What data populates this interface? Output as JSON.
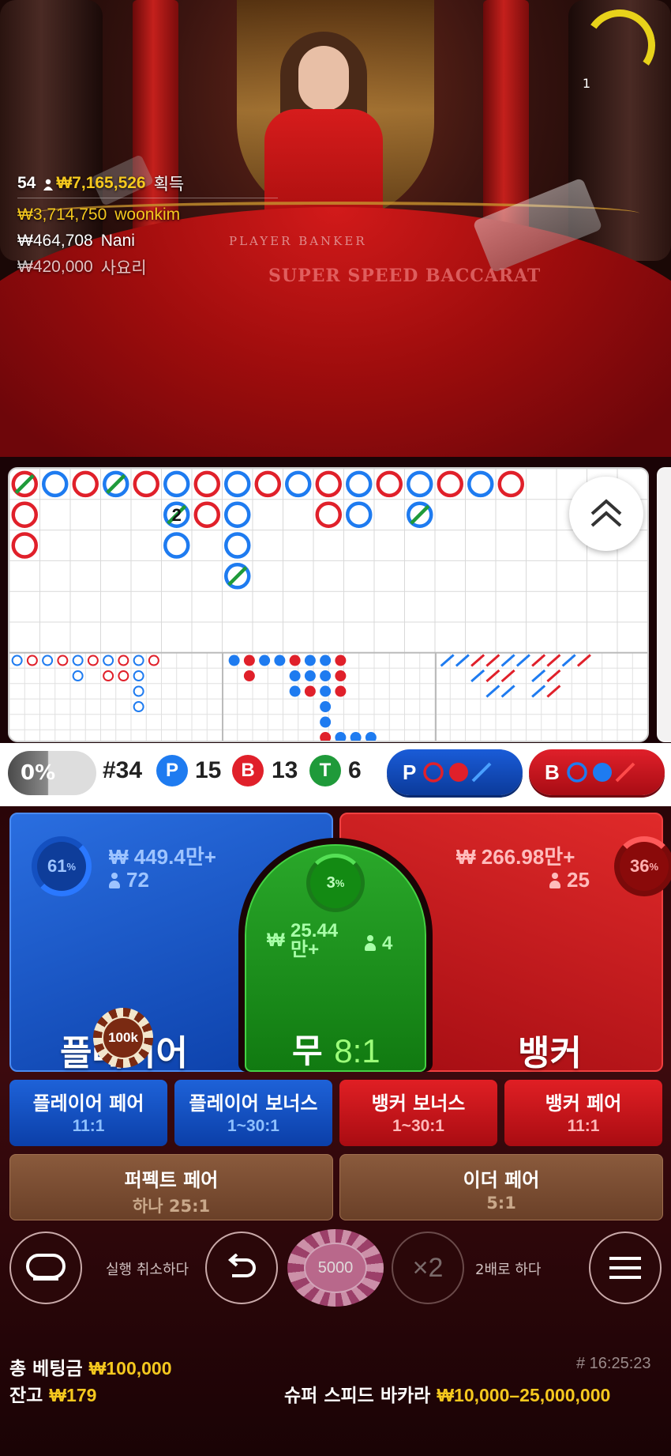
{
  "video": {
    "timer_value": "1",
    "table_print": "PLAYER        BANKER",
    "table_logo": "SUPER SPEED BACCARAT"
  },
  "winners": {
    "player_count": "54",
    "total_won": "₩7,165,526",
    "total_won_suffix": "획득",
    "rows": [
      {
        "amount": "₩3,714,750",
        "name": "woonkim"
      },
      {
        "amount": "₩464,708",
        "name": "Nani"
      },
      {
        "amount": "₩420,000",
        "name": "사요리"
      }
    ]
  },
  "roadmap": {
    "bead_marker": "2",
    "colors": {
      "player": "#1e7bf0",
      "banker": "#e0202a",
      "tie": "#1f9a3a"
    }
  },
  "stats": {
    "percent": "0%",
    "round": "#34",
    "player_letter": "P",
    "player_count": "15",
    "banker_letter": "B",
    "banker_count": "13",
    "tie_letter": "T",
    "tie_count": "6",
    "player_ask_label": "P",
    "banker_ask_label": "B"
  },
  "bets": {
    "player": {
      "pct": "61",
      "pct_sign": "%",
      "amount": "₩ 449.4만+",
      "bettors": "72",
      "label": "플레이어"
    },
    "banker": {
      "pct": "36",
      "pct_sign": "%",
      "amount": "₩ 266.98만+",
      "bettors": "25",
      "label": "뱅커"
    },
    "tie": {
      "pct": "3",
      "pct_sign": "%",
      "amount_line1": "25.44",
      "amount_prefix": "₩",
      "amount_line2": "만+",
      "bettors": "4",
      "label": "무",
      "odds": "8:1"
    },
    "placed_chip": "100k",
    "side_bets": [
      {
        "title": "플레이어 페어",
        "odds": "11:1"
      },
      {
        "title": "플레이어 보너스",
        "odds": "1~30:1"
      },
      {
        "title": "뱅커 보너스",
        "odds": "1~30:1"
      },
      {
        "title": "뱅커 페어",
        "odds": "11:1"
      }
    ],
    "perfect_pair": {
      "title": "퍼펙트 페어",
      "odds": "하나 25:1"
    },
    "either_pair": {
      "title": "이더 페어",
      "odds": "5:1"
    }
  },
  "controls": {
    "undo_label": "실행 취소하다",
    "chip_value": "5000",
    "double_label": "2배로 하다",
    "double_symbol": "×2"
  },
  "footer": {
    "total_bet_label": "총 베팅금",
    "total_bet_value": "₩100,000",
    "balance_label": "잔고",
    "balance_value": "₩179",
    "timestamp": "# 16:25:23",
    "game_name": "슈퍼 스피드 바카라",
    "limits": "₩10,000–25,000,000"
  }
}
